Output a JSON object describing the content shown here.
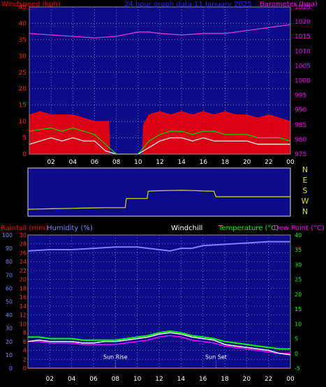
{
  "chart_data": [
    {
      "id": "wind",
      "type": "line",
      "title": "24 hour graph data 11 January 2025",
      "left_label": "Windspeed (kph)",
      "right_label": "Barometer (hpa)",
      "x_ticks": [
        "02",
        "04",
        "06",
        "08",
        "10",
        "12",
        "14",
        "16",
        "18",
        "20",
        "22",
        "00"
      ],
      "y_left_ticks": [
        "0",
        "5",
        "10",
        "15",
        "20",
        "25",
        "30",
        "35",
        "40",
        "45"
      ],
      "y_left_range": [
        0,
        45
      ],
      "y_right_ticks": [
        "975",
        "980",
        "985",
        "990",
        "995",
        "1000",
        "1005",
        "1010",
        "1015",
        "1020",
        "1025"
      ],
      "y_right_range": [
        975,
        1025
      ],
      "x_range_hours": [
        0,
        24
      ],
      "grid": true,
      "series": [
        {
          "key": "barometer",
          "axis": "right",
          "color": "#e040e0",
          "x": [
            0,
            2,
            4,
            6,
            8,
            10,
            11,
            12,
            14,
            16,
            18,
            20,
            22,
            24
          ],
          "y": [
            1016,
            1015.5,
            1015,
            1014.5,
            1015,
            1016.5,
            1016.5,
            1016,
            1015.5,
            1016,
            1016,
            1017,
            1018,
            1019
          ]
        },
        {
          "key": "gust",
          "axis": "left",
          "color": "#ff0000",
          "fill": true,
          "x": [
            0,
            1,
            2,
            3,
            4,
            5,
            6,
            7.3,
            7.4,
            10.4,
            10.5,
            11,
            12,
            13,
            14,
            15,
            16,
            17,
            18,
            19,
            20,
            21,
            22,
            23,
            24
          ],
          "y": [
            12,
            13,
            12,
            12,
            12,
            11,
            10,
            10,
            0,
            0,
            9,
            12,
            13,
            12,
            13,
            12,
            13,
            12,
            13,
            12,
            12,
            11,
            12,
            11,
            10
          ]
        },
        {
          "key": "average",
          "axis": "left",
          "color": "#00dd00",
          "x": [
            0,
            1,
            2,
            3,
            4,
            5,
            6,
            7,
            8,
            9,
            10,
            11,
            12,
            13,
            14,
            15,
            16,
            17,
            18,
            19,
            20,
            21,
            22,
            23,
            24
          ],
          "y": [
            7,
            7.5,
            8,
            7,
            8,
            7,
            6,
            3,
            0,
            0,
            0,
            4,
            6,
            7,
            7,
            6,
            7,
            7,
            6,
            6,
            6,
            5,
            5,
            5,
            4
          ]
        },
        {
          "key": "wind",
          "axis": "left",
          "color": "#ffffff",
          "x": [
            0,
            1,
            2,
            3,
            4,
            5,
            6,
            7,
            8,
            9,
            10,
            11,
            12,
            13,
            14,
            15,
            16,
            17,
            18,
            19,
            20,
            21,
            22,
            23,
            24
          ],
          "y": [
            3,
            4,
            5,
            4,
            5,
            4,
            4,
            1,
            0,
            0,
            0,
            2,
            4,
            5,
            5,
            4,
            5,
            4,
            4,
            4,
            4,
            3,
            3,
            3,
            3
          ]
        }
      ]
    },
    {
      "id": "direction",
      "type": "line",
      "y_labels": [
        "N",
        "E",
        "S",
        "W",
        "N"
      ],
      "y_range": [
        0,
        360
      ],
      "x_range_hours": [
        0,
        24
      ],
      "series": [
        {
          "key": "direction",
          "color": "#e0e000",
          "x": [
            0,
            1,
            2,
            3,
            4,
            5,
            6,
            7,
            8,
            8.9,
            9,
            10,
            10.9,
            11,
            12,
            13,
            14,
            15,
            16,
            17,
            17.2,
            18,
            19,
            20,
            21,
            22,
            23,
            24
          ],
          "y": [
            30,
            32,
            34,
            36,
            38,
            40,
            42,
            44,
            44,
            44,
            124,
            124,
            124,
            188,
            192,
            194,
            196,
            194,
            190,
            188,
            140,
            140,
            140,
            140,
            140,
            140,
            140,
            140
          ]
        }
      ]
    },
    {
      "id": "temp",
      "type": "line",
      "left_labels": [
        "Rainfall (mm)",
        "Humidity (%)"
      ],
      "center_label": "Windchill",
      "right_labels": [
        "Temperature (°C)",
        "Dew Point (°C)"
      ],
      "x_ticks": [
        "02",
        "04",
        "06",
        "08",
        "10",
        "12",
        "14",
        "16",
        "18",
        "20",
        "22",
        "00"
      ],
      "y_left_ticks": [
        "0",
        "10",
        "20",
        "30",
        "40",
        "50",
        "60",
        "70",
        "80",
        "90",
        "100"
      ],
      "y_left_range": [
        0,
        100
      ],
      "y_rain_ticks": [
        "0",
        "2",
        "4",
        "6",
        "8",
        "10",
        "12",
        "14",
        "16",
        "18",
        "20",
        "22",
        "24",
        "26",
        "28",
        "30"
      ],
      "y_rain_range": [
        0,
        30
      ],
      "y_right_ticks": [
        "-5",
        "0",
        "5",
        "10",
        "15",
        "20",
        "25",
        "30",
        "35",
        "40"
      ],
      "y_right_range": [
        -5,
        40
      ],
      "x_range_hours": [
        0,
        24
      ],
      "grid": true,
      "annotations": [
        {
          "text": "Sun Rise",
          "x_hour": 8.0
        },
        {
          "text": "Sun Set",
          "x_hour": 17.2
        }
      ],
      "series": [
        {
          "key": "humidity",
          "axis": "left",
          "color": "#8080ff",
          "x": [
            0,
            2,
            4,
            6,
            8,
            10,
            11,
            12,
            13,
            14,
            15,
            16,
            18,
            20,
            22,
            24
          ],
          "y": [
            88,
            89,
            89,
            90,
            91,
            91,
            90,
            89,
            88,
            90,
            90,
            92,
            93,
            94,
            95,
            95
          ]
        },
        {
          "key": "temperature",
          "axis": "right",
          "color": "#00ff00",
          "x": [
            0,
            1,
            2,
            3,
            4,
            5,
            6,
            7,
            8,
            9,
            10,
            11,
            12,
            13,
            14,
            15,
            16,
            17,
            18,
            19,
            20,
            21,
            22,
            23,
            24
          ],
          "y": [
            5.5,
            5.5,
            5,
            5,
            5,
            4.5,
            4.5,
            4.5,
            4.5,
            5,
            5.5,
            6,
            7,
            7.5,
            7,
            6,
            5.5,
            5,
            4,
            3.5,
            3,
            2.5,
            2,
            1.5,
            1.5
          ]
        },
        {
          "key": "dewpoint",
          "axis": "right",
          "color": "#ff00ff",
          "x": [
            0,
            1,
            2,
            3,
            4,
            5,
            6,
            7,
            8,
            9,
            10,
            11,
            12,
            13,
            14,
            15,
            16,
            17,
            18,
            19,
            20,
            21,
            22,
            23,
            24
          ],
          "y": [
            4,
            4,
            3.5,
            3.5,
            3.5,
            3,
            3,
            3,
            3,
            3.5,
            4,
            4.5,
            5.5,
            6,
            5.5,
            4.5,
            4,
            3.5,
            2.5,
            2,
            1.5,
            1,
            0.5,
            0,
            0
          ]
        },
        {
          "key": "windchill",
          "axis": "right",
          "color": "#ffffff",
          "x": [
            0,
            1,
            2,
            3,
            4,
            5,
            6,
            7,
            8,
            9,
            10,
            11,
            12,
            13,
            14,
            15,
            16,
            17,
            18,
            19,
            20,
            21,
            22,
            23,
            24
          ],
          "y": [
            4,
            4.5,
            4,
            4,
            4,
            3.5,
            3.5,
            4,
            4,
            4.5,
            5,
            5.5,
            6.5,
            7,
            6.5,
            5.5,
            5,
            4.5,
            3,
            2.5,
            2,
            1.5,
            1,
            0,
            -0.5
          ]
        },
        {
          "key": "rainfall",
          "axis": "rain",
          "color": "#ff2020",
          "x": [
            0,
            24
          ],
          "y": [
            0,
            0
          ]
        }
      ]
    }
  ]
}
